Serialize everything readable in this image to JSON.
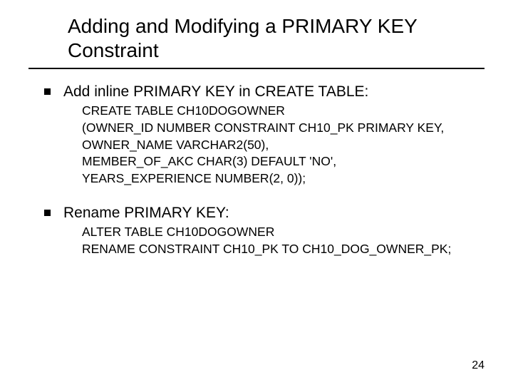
{
  "title": "Adding and Modifying a PRIMARY KEY Constraint",
  "sections": [
    {
      "heading": "Add inline PRIMARY KEY in CREATE TABLE:",
      "code": "CREATE TABLE CH10DOGOWNER\n(OWNER_ID NUMBER CONSTRAINT CH10_PK PRIMARY KEY,\nOWNER_NAME VARCHAR2(50),\nMEMBER_OF_AKC CHAR(3) DEFAULT 'NO',\nYEARS_EXPERIENCE NUMBER(2, 0));"
    },
    {
      "heading": "Rename PRIMARY KEY:",
      "code": "ALTER TABLE CH10DOGOWNER\nRENAME CONSTRAINT CH10_PK TO CH10_DOG_OWNER_PK;"
    }
  ],
  "page_number": "24"
}
